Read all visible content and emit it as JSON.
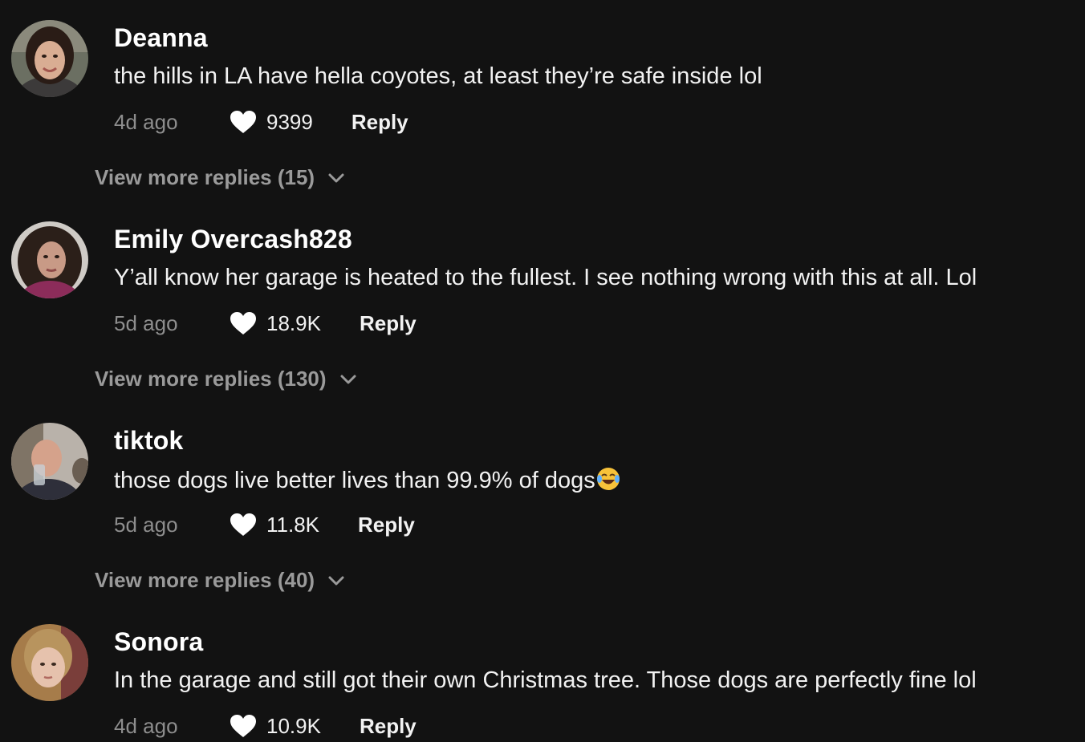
{
  "comments": [
    {
      "username": "Deanna",
      "text": "the hills in LA have hella coyotes, at least they’re safe inside lol",
      "time": "4d ago",
      "likes": "9399",
      "reply_label": "Reply",
      "more_replies": "View more replies (15)"
    },
    {
      "username": "Emily Overcash828",
      "text": "Y’all know her garage is heated to the fullest. I see nothing wrong with this at all. Lol",
      "time": "5d ago",
      "likes": "18.9K",
      "reply_label": "Reply",
      "more_replies": "View more replies (130)"
    },
    {
      "username": "tiktok",
      "text": "those dogs live better lives than 99.9% of dogs",
      "emoji": "face-with-tears-of-joy-icon",
      "time": "5d ago",
      "likes": "11.8K",
      "reply_label": "Reply",
      "more_replies": "View more replies (40)"
    },
    {
      "username": "Sonora",
      "text": "In the garage and still got their own Christmas tree. Those dogs are perfectly fine lol",
      "time": "4d ago",
      "likes": "10.9K",
      "reply_label": "Reply"
    }
  ],
  "colors": {
    "background": "#121212",
    "primary_text": "#ffffff",
    "secondary_text": "#8e8e8e"
  }
}
